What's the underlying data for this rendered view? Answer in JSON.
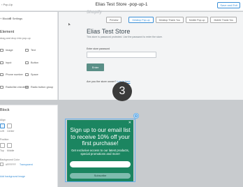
{
  "topbar": {
    "crumb": "‹ Pop-Up",
    "title": "Elias Test Store -pop-up-1",
    "save_label": "Save and Exit"
  },
  "sidebar": {
    "tabs": [
      "+ Blocks",
      "⚙ Settings"
    ],
    "section_title": "Element",
    "section_subtitle": "drag and drop into pop-up",
    "elements": [
      "Image",
      "Text",
      "Input",
      "Button",
      "Phone number",
      "Space",
      "Radio/list checkbox",
      "Radio button group"
    ]
  },
  "block_settings": {
    "title": "Block",
    "align_caption": "Align",
    "align_options": [
      "Left",
      "Center",
      "Right"
    ],
    "position_caption": "Position",
    "position_options": [
      "Top",
      "Middle",
      "Bottom"
    ],
    "background_caption": "Background Color",
    "background_value": "#FFFFFF",
    "transparent_label": "Transparent",
    "image_link": "Add background image"
  },
  "preview": {
    "logo": "Shopify",
    "buttons": [
      "Preview",
      "Desktop Pop-up",
      "Desktop Thank You",
      "Mobile Pop-up",
      "Mobile Thank You"
    ],
    "selected": "Desktop Pop-up"
  },
  "store": {
    "title": "Elias Test Store",
    "subtitle": "This store is password protected. Use the password to enter the store.",
    "password_label": "Enter store password",
    "enter_label": "Enter",
    "owner_text": "Are you the store owner?",
    "owner_link": "Log in here"
  },
  "step_number": "3",
  "popup": {
    "close": "✕",
    "headline": "Sign up to our email list to receive 10% off your first purchase!",
    "body": "Get exclusive access to our latest products, special promotions and more!",
    "email_placeholder": "",
    "subscribe_label": "Subscribe",
    "colors": {
      "background": "#1b8560",
      "button": "#7fbcae"
    }
  }
}
